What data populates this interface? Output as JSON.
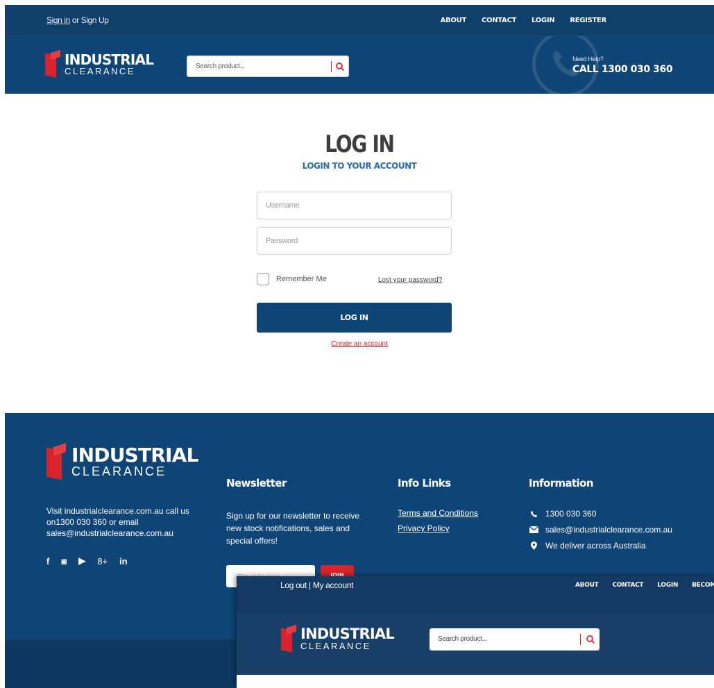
{
  "topbar": {
    "signin": "Sign in",
    "or_signup": " or Sign Up",
    "nav": [
      "ABOUT",
      "CONTACT",
      "LOGIN",
      "REGISTER"
    ]
  },
  "header": {
    "logo_line1": "INDUSTRIAL",
    "logo_line2": "CLEARANCE",
    "search_placeholder": "Search product...",
    "help_small": "Need Help?",
    "help_phone": "CALL 1300 030 360"
  },
  "login": {
    "title": "LOG IN",
    "subtitle": "LOGIN TO YOUR ACCOUNT",
    "username_placeholder": "Username",
    "password_placeholder": "Password",
    "remember": "Remember Me",
    "lost_password": "Lost your password?",
    "button": "LOG IN",
    "create_account": "Create an account"
  },
  "footer": {
    "logo_line1": "INDUSTRIAL",
    "logo_line2": "CLEARANCE",
    "description": "Visit industrialclearance.com.au call us on1300 030 360 or email sales@industrialclearance.com.au",
    "social": [
      "f",
      "◙",
      "▶",
      "8+",
      "in"
    ],
    "newsletter": {
      "heading": "Newsletter",
      "text": "Sign up for our newsletter to receive new stock notifications, sales and special offers!",
      "input_placeholder": "Sign up for news",
      "button": "JOIN"
    },
    "info_links": {
      "heading": "Info Links",
      "links": [
        "Terms and Conditions",
        "Privacy Policy"
      ]
    },
    "information": {
      "heading": "Information",
      "phone": "1300 030 360",
      "email": "sales@industrialclearance.com.au",
      "delivery": "We deliver across Australia"
    }
  },
  "overlay": {
    "auth": "Log out  |  My account",
    "nav": [
      "ABOUT",
      "CONTACT",
      "LOGIN",
      "BECOME"
    ],
    "logo_line1": "INDUSTRIAL",
    "logo_line2": "CLEARANCE",
    "search_placeholder": "Search product..."
  },
  "colors": {
    "navy": "#0f4576",
    "red": "#d8232a",
    "accent_blue": "#2b6fb0"
  }
}
